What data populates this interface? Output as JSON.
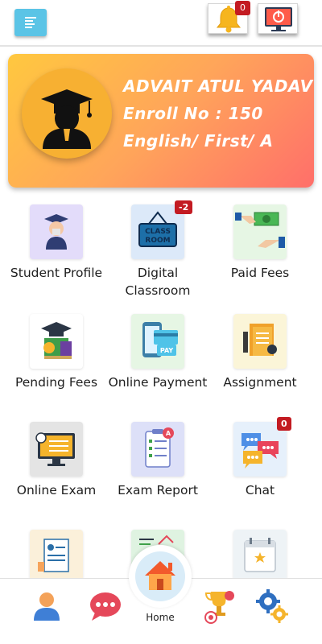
{
  "header": {
    "menu_icon": "menu-icon",
    "notification_icon": "bell-icon",
    "notification_count": "0",
    "logout_icon": "power-icon"
  },
  "profile": {
    "name": "ADVAIT ATUL YADAV",
    "enroll": "Enroll No : 150",
    "class_info": "English/ First/ A",
    "avatar_icon": "graduate-icon"
  },
  "tiles": [
    {
      "label": "Student Profile",
      "icon": "student-icon",
      "badge": ""
    },
    {
      "label": "Digital Classroom",
      "icon": "classroom-sign-icon",
      "badge": "-2"
    },
    {
      "label": "Paid Fees",
      "icon": "money-hand-icon",
      "badge": ""
    },
    {
      "label": "Pending Fees",
      "icon": "pending-fees-icon",
      "badge": ""
    },
    {
      "label": "Online Payment",
      "icon": "phone-pay-icon",
      "badge": ""
    },
    {
      "label": "Assignment",
      "icon": "assignment-icon",
      "badge": ""
    },
    {
      "label": "Online Exam",
      "icon": "monitor-exam-icon",
      "badge": ""
    },
    {
      "label": "Exam Report",
      "icon": "report-clipboard-icon",
      "badge": ""
    },
    {
      "label": "Chat",
      "icon": "chat-bubbles-icon",
      "badge": "0"
    },
    {
      "label": "",
      "icon": "document-icon",
      "badge": ""
    },
    {
      "label": "",
      "icon": "chart-icon",
      "badge": ""
    },
    {
      "label": "",
      "icon": "calendar-icon",
      "badge": ""
    }
  ],
  "bottom_nav": {
    "home_label": "Home",
    "items": [
      "profile-icon",
      "chat-icon",
      "home-icon",
      "trophy-icon",
      "settings-icon"
    ]
  },
  "colors": {
    "accent": "#5bc4e6",
    "badge": "#c31b22",
    "card_gradient_start": "#ffc83f",
    "card_gradient_end": "#ff6f6a"
  }
}
